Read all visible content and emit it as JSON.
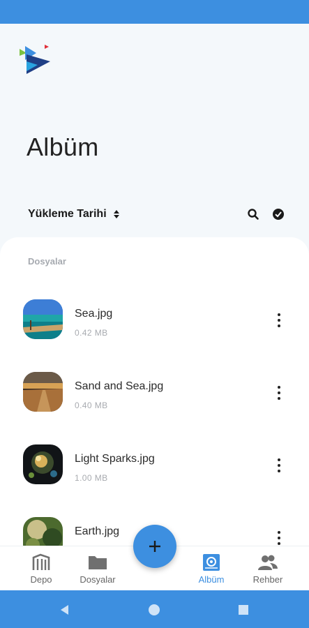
{
  "header": {
    "title": "Albüm"
  },
  "sort": {
    "label": "Yükleme Tarihi"
  },
  "section": {
    "label": "Dosyalar"
  },
  "files": [
    {
      "name": "Sea.jpg",
      "size": "0.42  MB"
    },
    {
      "name": "Sand and Sea.jpg",
      "size": "0.40  MB"
    },
    {
      "name": "Light Sparks.jpg",
      "size": "1.00  MB"
    },
    {
      "name": "Earth.jpg",
      "size": ""
    }
  ],
  "nav": {
    "items": [
      {
        "label": "Depo",
        "icon": "storage-icon"
      },
      {
        "label": "Dosyalar",
        "icon": "folder-icon"
      },
      {
        "label": "Albüm",
        "icon": "album-icon",
        "active": true
      },
      {
        "label": "Rehber",
        "icon": "contacts-icon"
      }
    ]
  },
  "colors": {
    "accent": "#3d8fe0",
    "background": "#f4f8fb",
    "muted": "#a8abb0"
  }
}
